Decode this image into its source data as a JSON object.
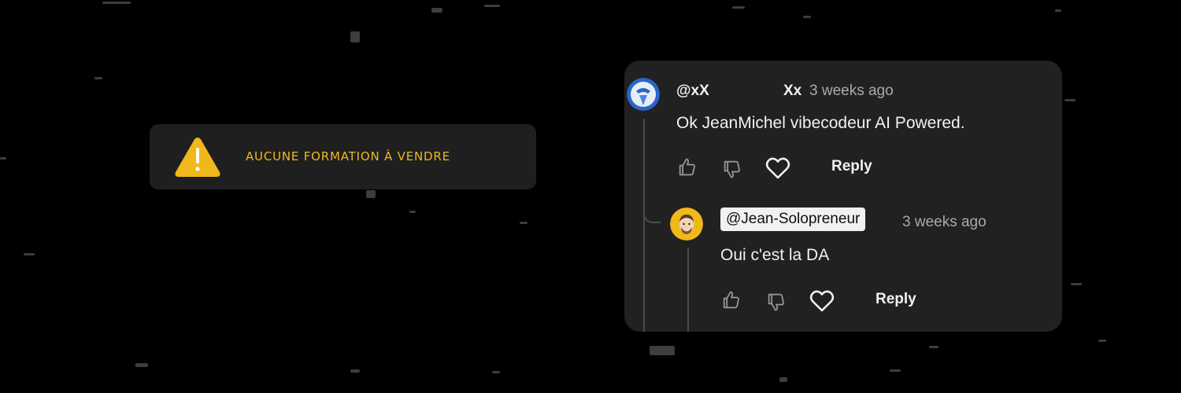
{
  "warning": {
    "icon": "warning-icon",
    "text": "AUCUNE FORMATION À VENDRE",
    "color": "#f0b81b"
  },
  "comment": {
    "author": "@xX",
    "author_extra": "Xx",
    "timestamp": "3 weeks ago",
    "text": "Ok JeanMichel vibecodeur AI Powered.",
    "reply_label": "Reply"
  },
  "reply": {
    "author": "@Jean-Solopreneur",
    "timestamp": "3 weeks ago",
    "text": "Oui c'est la DA",
    "reply_label": "Reply"
  },
  "icons": [
    "thumb-up-icon",
    "thumb-down-icon",
    "heart-icon"
  ]
}
